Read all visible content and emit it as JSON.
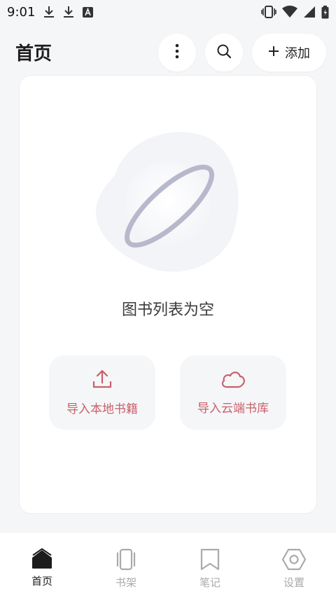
{
  "status_bar": {
    "time": "9:01",
    "left_icons": [
      "download-icon",
      "download-icon",
      "translate-a-icon"
    ],
    "right_icons": [
      "vibrate-icon",
      "wifi-icon",
      "signal-icon",
      "battery-icon"
    ]
  },
  "header": {
    "title": "首页",
    "add_label": "添加"
  },
  "empty_state": {
    "illustration": "planet-icon",
    "message": "图书列表为空"
  },
  "actions": {
    "import_local": "导入本地书籍",
    "import_cloud": "导入云端书库"
  },
  "bottom_nav": {
    "items": [
      {
        "label": "首页",
        "icon": "home-icon",
        "active": true
      },
      {
        "label": "书架",
        "icon": "bookshelf-icon",
        "active": false
      },
      {
        "label": "笔记",
        "icon": "bookmark-icon",
        "active": false
      },
      {
        "label": "设置",
        "icon": "settings-hexagon-icon",
        "active": false
      }
    ]
  },
  "colors": {
    "accent": "#c8606a",
    "background": "#f5f6f8",
    "inactive": "#aaaaaa"
  }
}
